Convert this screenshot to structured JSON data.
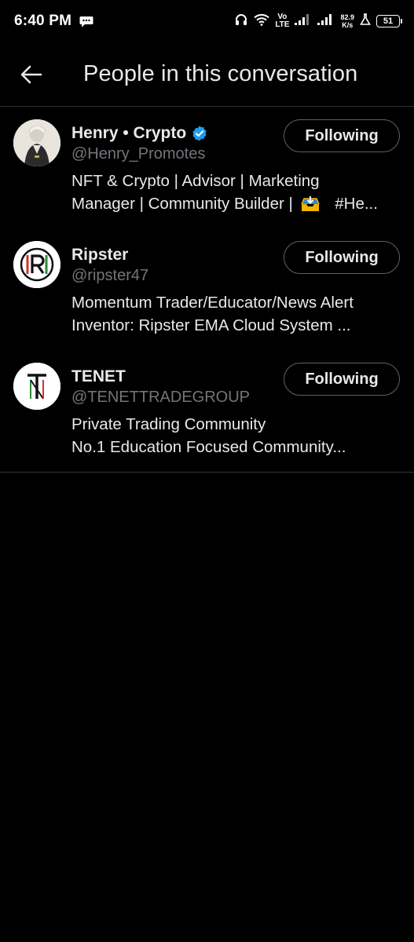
{
  "status_bar": {
    "time": "6:40 PM",
    "volte_top": "Vo",
    "volte_bottom": "LTE",
    "speed_top": "82.9",
    "speed_bottom": "K/s",
    "battery": "51"
  },
  "header": {
    "title": "People in this conversation"
  },
  "people": [
    {
      "name": "Henry • Crypto",
      "verified": true,
      "handle": "@Henry_Promotes",
      "bio_line1": "NFT & Crypto | Advisor | Marketing",
      "bio_line2_a": "Manager | Community Builder |",
      "bio_line2_b": "#He...",
      "follow_label": "Following",
      "avatar_icon": "person-photo-icon"
    },
    {
      "name": "Ripster",
      "verified": false,
      "handle": "@ripster47",
      "bio_line1": "Momentum Trader/Educator/News Alert",
      "bio_line2": "Inventor: Ripster EMA Cloud System  ...",
      "follow_label": "Following",
      "avatar_icon": "ripster-logo-icon"
    },
    {
      "name": "TENET",
      "verified": false,
      "handle": "@TENETTRADEGROUP",
      "bio_line1": "Private Trading Community",
      "bio_line2": "No.1 Education Focused Community...",
      "follow_label": "Following",
      "avatar_icon": "tenet-logo-icon"
    }
  ],
  "colors": {
    "background": "#000000",
    "text_primary": "#e7e9ea",
    "text_secondary": "#71767b",
    "divider": "#2f3336",
    "verified": "#1d9bf0",
    "button_border": "#536471"
  }
}
